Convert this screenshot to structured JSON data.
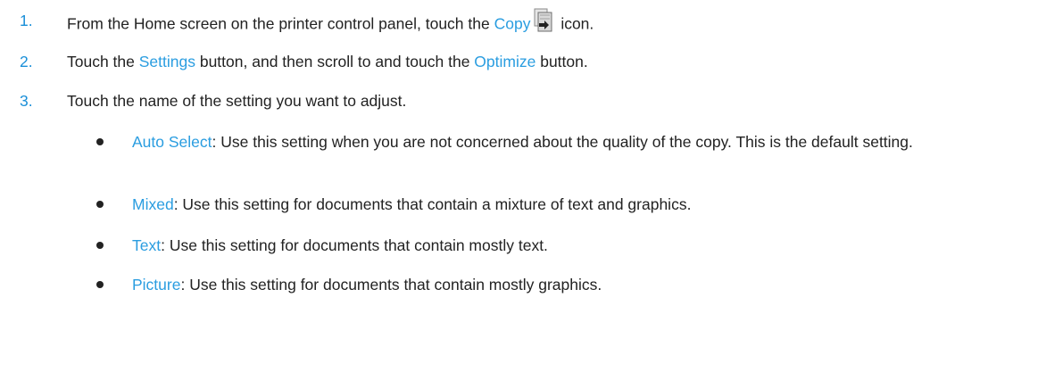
{
  "steps": [
    {
      "number": "1.",
      "before": "From the Home screen on the printer control panel, touch the ",
      "link1": "Copy",
      "icon": "copy-icon",
      "after": " icon."
    },
    {
      "number": "2.",
      "before": "Touch the ",
      "link1": "Settings",
      "middle": " button, and then scroll to and touch the ",
      "link2": "Optimize",
      "after": " button."
    },
    {
      "number": "3.",
      "text": "Touch the name of the setting you want to adjust."
    }
  ],
  "options": [
    {
      "name": "Auto Select",
      "description": ": Use this setting when you are not concerned about the quality of the copy. This is the default setting."
    },
    {
      "name": "Mixed",
      "description": ": Use this setting for documents that contain a mixture of text and graphics."
    },
    {
      "name": "Text",
      "description": ": Use this setting for documents that contain mostly text."
    },
    {
      "name": "Picture",
      "description": ": Use this setting for documents that contain mostly graphics."
    }
  ],
  "colors": {
    "accent": "#2a9de0",
    "number": "#1a8fd8",
    "text": "#222222"
  }
}
